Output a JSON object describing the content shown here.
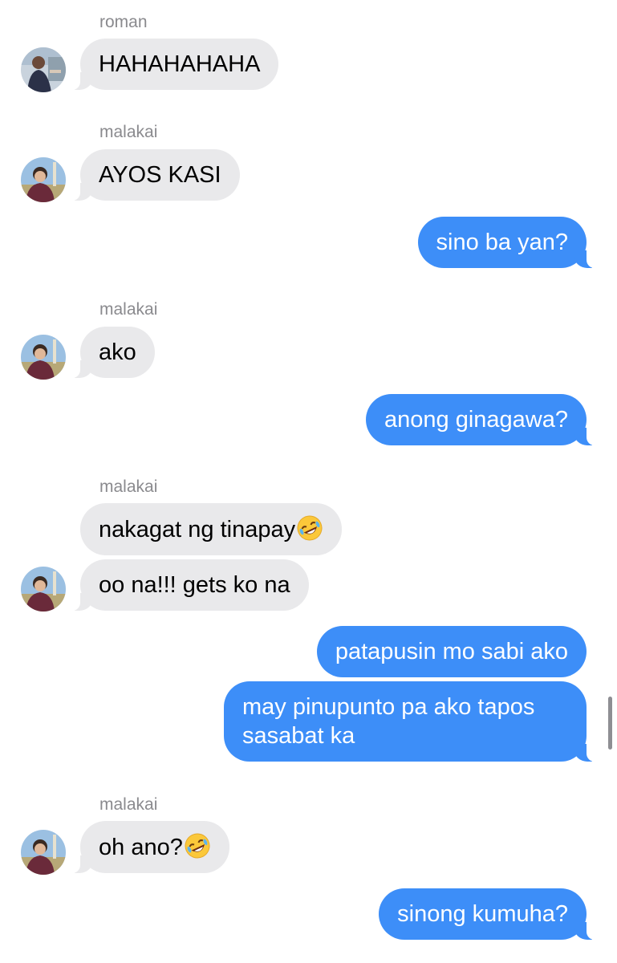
{
  "thread": {
    "senders": {
      "roman": "roman",
      "malakai_1": "malakai",
      "malakai_2": "malakai",
      "malakai_3": "malakai",
      "malakai_4": "malakai"
    },
    "messages": {
      "m1": "HAHAHAHAHA",
      "m2": "AYOS KASI",
      "m3": "sino ba yan?",
      "m4": "ako",
      "m5": "anong ginagawa?",
      "m6": "nakagat ng tinapay",
      "m7": "oo na!!! gets ko na",
      "m8": "patapusin mo sabi ako",
      "m9": "may pinupunto pa ako tapos sasabat ka",
      "m10": "oh ano?",
      "m11": "sinong kumuha?"
    },
    "emoji": {
      "m6": "rolling-on-floor-laughing",
      "m10": "rolling-on-floor-laughing"
    }
  },
  "colors": {
    "incoming_bubble": "#e9e9eb",
    "outgoing_bubble": "#3d8ef8",
    "sender_name": "#8a8a8e",
    "background": "#ffffff"
  }
}
